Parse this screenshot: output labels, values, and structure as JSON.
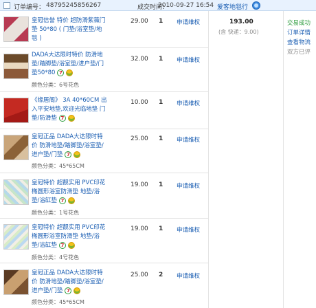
{
  "order": {
    "number_label": "订单编号：",
    "number": "48795245856267",
    "time_label": "成交时间：",
    "time": "2010-09-27 16:54",
    "seller": "爱客地毯行"
  },
  "items": [
    {
      "title": "皇冠信誉 特价 超防滑紫薇门垫 50*80 ( 门垫/浴室垫/地毯 )",
      "attr": "",
      "price": "29.00",
      "qty": "1",
      "refund": "申请维权"
    },
    {
      "title": "DADA大达限时特价 防滑地垫/踏脚垫/浴室垫/进户垫/门垫50*80",
      "attr": "颜色分类：6号花色",
      "price": "32.00",
      "qty": "1",
      "refund": "申请维权"
    },
    {
      "title": "《缘居阁》 3A 40*60CM 出入平安地垫,欢迎光临地垫 门垫/防滑垫",
      "attr": "",
      "price": "10.00",
      "qty": "1",
      "refund": "申请维权"
    },
    {
      "title": "皇冠正品 DADA大达限时特价 防滑地垫/踏脚垫/浴室垫/进户垫/门垫",
      "attr": "颜色分类：45*65CM",
      "price": "25.00",
      "qty": "1",
      "refund": "申请维权"
    },
    {
      "title": "皇冠特价 超靓实用 PVC印花椭圆形浴室防滑垫 地垫/浴垫/浴缸垫",
      "attr": "颜色分类：1号花色",
      "price": "19.00",
      "qty": "1",
      "refund": "申请维权"
    },
    {
      "title": "皇冠特价 超靓实用 PVC印花椭圆形浴室防滑垫 地垫/浴垫/浴缸垫",
      "attr": "颜色分类：4号花色",
      "price": "19.00",
      "qty": "1",
      "refund": "申请维权"
    },
    {
      "title": "皇冠正品 DADA大达限时特价 防滑地垫/踏脚垫/浴室垫/进户垫/门垫",
      "attr": "颜色分类：45*65CM",
      "price": "25.00",
      "qty": "2",
      "refund": "申请维权"
    }
  ],
  "summary": {
    "total": "193.00",
    "shipping": "(含 快递：9.00)"
  },
  "status": {
    "state": "交易成功",
    "details": "订单详情",
    "logistics": "查看物流",
    "review": "双方已评"
  },
  "colors": {
    "link": "#1c5fb3",
    "success": "#2a9b3b",
    "header_bg": "#e8f2fe"
  }
}
